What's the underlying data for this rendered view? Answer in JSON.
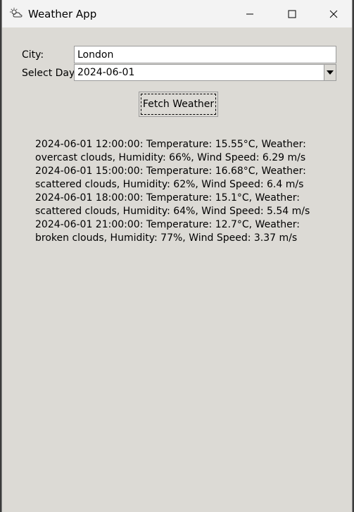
{
  "window": {
    "title": "Weather App"
  },
  "form": {
    "city_label": "City:",
    "city_value": "London",
    "day_label": "Select Day:",
    "day_value": "2024-06-01",
    "fetch_label": "Fetch Weather"
  },
  "results": [
    "2024-06-01 12:00:00: Temperature: 15.55°C, Weather: overcast clouds, Humidity: 66%, Wind Speed: 6.29 m/s",
    "2024-06-01 15:00:00: Temperature: 16.68°C, Weather: scattered clouds, Humidity: 62%, Wind Speed: 6.4 m/s",
    "2024-06-01 18:00:00: Temperature: 15.1°C, Weather: scattered clouds, Humidity: 64%, Wind Speed: 5.54 m/s",
    "2024-06-01 21:00:00: Temperature: 12.7°C, Weather: broken clouds, Humidity: 77%, Wind Speed: 3.37 m/s"
  ],
  "icons": {
    "app": "weather-cloud-sun-icon",
    "minimize": "minimize-icon",
    "maximize": "maximize-icon",
    "close": "close-icon",
    "dropdown": "chevron-down-icon"
  }
}
